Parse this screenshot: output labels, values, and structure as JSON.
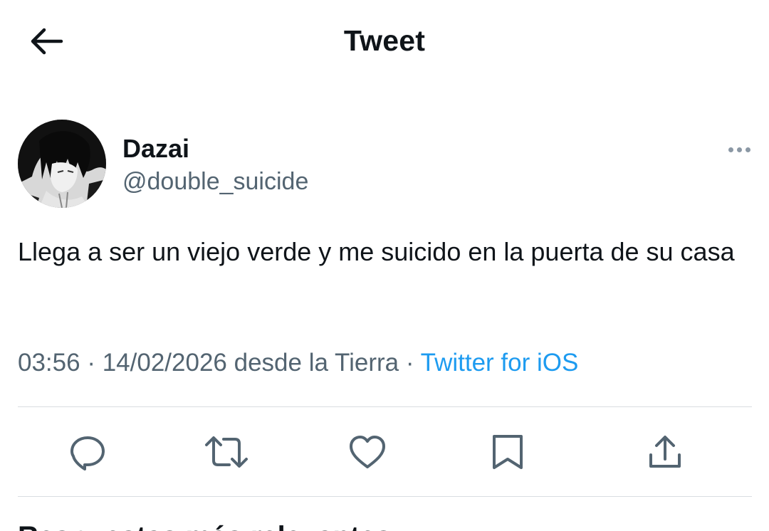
{
  "header": {
    "back_icon": "arrow-left-icon",
    "title": "Tweet"
  },
  "author": {
    "name": "Dazai",
    "handle": "@double_suicide",
    "more_icon": "more-horizontal-icon"
  },
  "tweet": {
    "text": "Llega a ser un viejo verde y me suicido en la puerta de su casa",
    "time": "03:56",
    "date": "14/02/2026",
    "location": "desde la Tierra",
    "separator": "·",
    "source": "Twitter for iOS"
  },
  "actions": [
    {
      "icon": "reply-icon"
    },
    {
      "icon": "retweet-icon"
    },
    {
      "icon": "like-icon"
    },
    {
      "icon": "bookmark-icon"
    },
    {
      "icon": "share-icon"
    }
  ],
  "next_section": {
    "title": "Respuestas más relevantes"
  },
  "colors": {
    "text": "#0f1419",
    "secondary": "#536471",
    "link": "#1d9bf0",
    "divider": "#d9dde1"
  }
}
